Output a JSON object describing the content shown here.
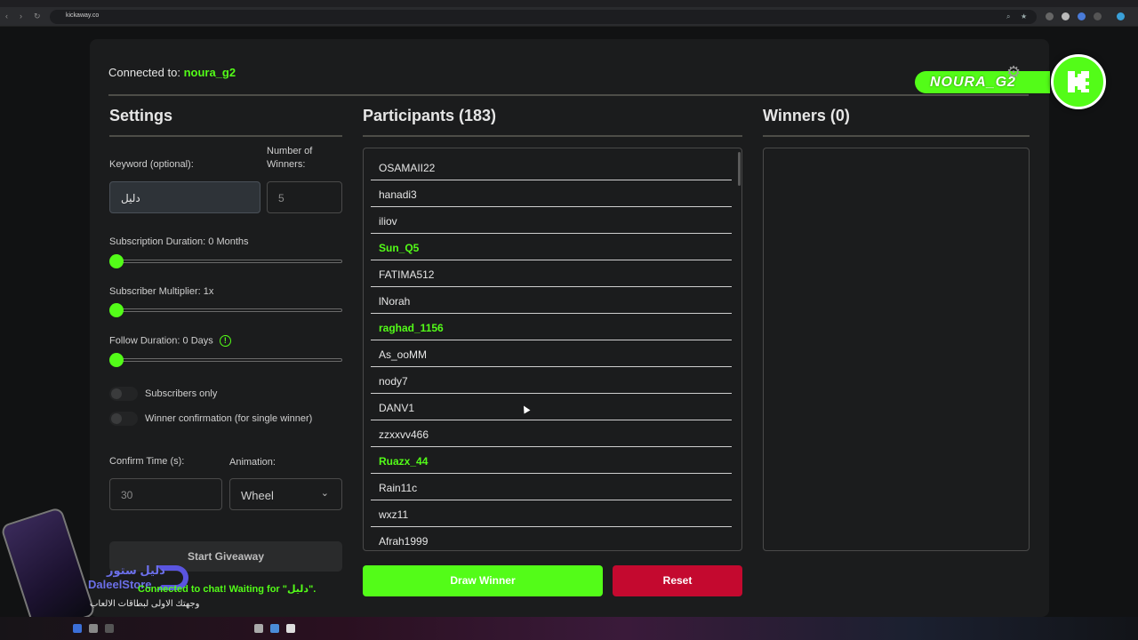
{
  "browser": {
    "url": "kickaway.co"
  },
  "header": {
    "connected_label": "Connected to:",
    "channel": "noura_g2",
    "badge_name": "NOURA_G2"
  },
  "settings": {
    "title": "Settings",
    "keyword_label": "Keyword (optional):",
    "keyword_value": "دليل",
    "winners_label_line1": "Number of",
    "winners_label_line2": "Winners:",
    "winners_placeholder": "5",
    "subscription_duration_label": "Subscription Duration: 0 Months",
    "subscription_duration_value": 0,
    "subscriber_multiplier_label": "Subscriber Multiplier: 1x",
    "subscriber_multiplier_value": 1,
    "follow_duration_label": "Follow Duration: 0 Days",
    "follow_duration_value": 0,
    "info_glyph": "!",
    "subscribers_only_label": "Subscribers only",
    "subscribers_only": false,
    "winner_confirmation_label": "Winner confirmation (for single winner)",
    "winner_confirmation": false,
    "confirm_time_label": "Confirm Time (s):",
    "confirm_time_placeholder": "30",
    "animation_label": "Animation:",
    "animation_value": "Wheel",
    "start_label": "Start Giveaway",
    "status_text": "Connected to chat! Waiting for \"دليل\"."
  },
  "participants": {
    "title": "Participants (183)",
    "rows": [
      {
        "name": "OSAMAII22",
        "subscriber": false
      },
      {
        "name": "hanadi3",
        "subscriber": false
      },
      {
        "name": "iliov",
        "subscriber": false
      },
      {
        "name": "Sun_Q5",
        "subscriber": true
      },
      {
        "name": "FATIMA512",
        "subscriber": false
      },
      {
        "name": "lNorah",
        "subscriber": false
      },
      {
        "name": "raghad_1156",
        "subscriber": true
      },
      {
        "name": "As_ooMM",
        "subscriber": false
      },
      {
        "name": "nody7",
        "subscriber": false
      },
      {
        "name": "DANV1",
        "subscriber": false
      },
      {
        "name": "zzxxvv466",
        "subscriber": false
      },
      {
        "name": "Ruazx_44",
        "subscriber": true
      },
      {
        "name": "Rain11c",
        "subscriber": false
      },
      {
        "name": "wxz11",
        "subscriber": false
      },
      {
        "name": "Afrah1999",
        "subscriber": false
      }
    ],
    "draw_label": "Draw Winner",
    "reset_label": "Reset"
  },
  "winners": {
    "title": "Winners (0)"
  },
  "overlay": {
    "brand_arabic": "دليل ستور",
    "brand_english": "DaleelStore",
    "tagline": "وجهتك الاولى لبطاقات الالعاب"
  },
  "colors": {
    "accent": "#53fc18",
    "danger": "#c4092f",
    "card": "#1b1c1d"
  }
}
